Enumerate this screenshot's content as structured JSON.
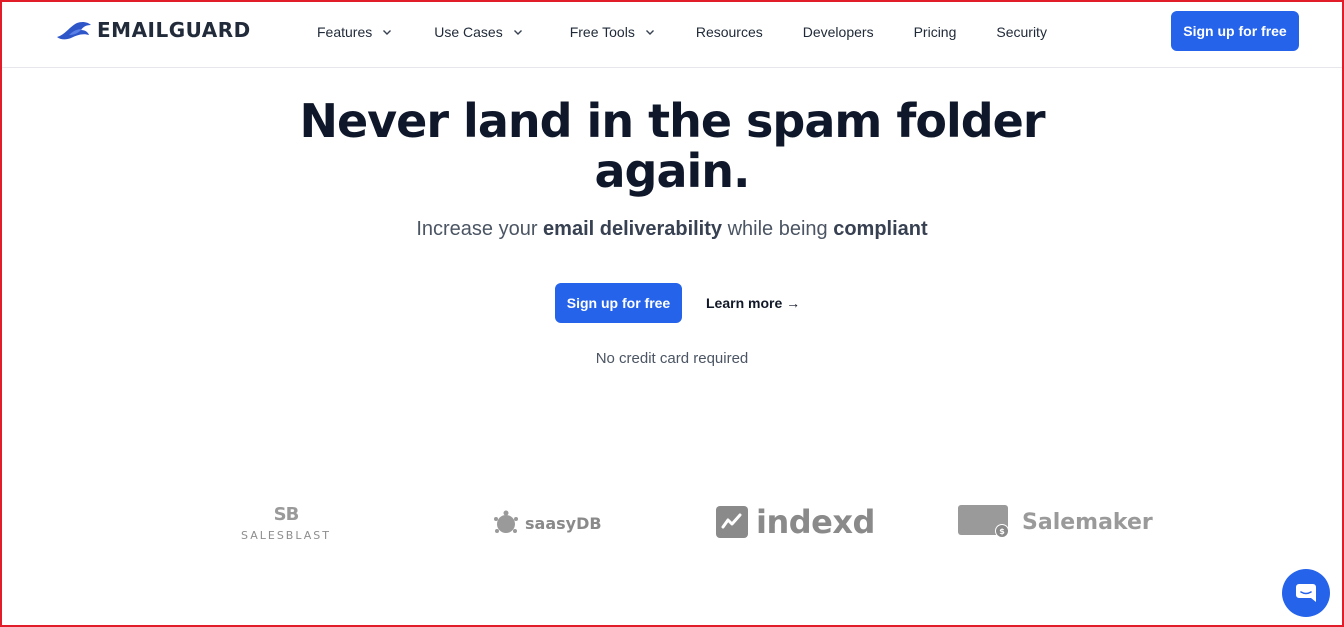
{
  "header": {
    "logo_text": "EMAILGUARD",
    "nav": {
      "features": "Features",
      "use_cases": "Use Cases",
      "free_tools": "Free Tools",
      "resources": "Resources",
      "developers": "Developers",
      "pricing": "Pricing",
      "security": "Security"
    },
    "cta": "Sign up for free"
  },
  "hero": {
    "title_line1": "Never land in the spam folder",
    "title_line2": "again.",
    "sub_pre": "Increase your ",
    "sub_bold1": "email deliverability",
    "sub_mid": " while being ",
    "sub_bold2": "compliant",
    "cta": "Sign up for free",
    "learn_more": "Learn more →",
    "note": "No credit card required"
  },
  "logos": {
    "salesblast_mark": "SB",
    "salesblast": "SALESBLAST",
    "saasydb": "saasyDB",
    "indexd": "indexd",
    "salemaker": "Salemaker"
  },
  "colors": {
    "primary": "#2563eb",
    "heading": "#0f172a",
    "muted": "#4b5563",
    "logo_gray": "#8a8a8a"
  },
  "icons": {
    "brand": "bird-logo-icon",
    "dropdown": "chevron-down-icon",
    "chat": "chat-icon"
  }
}
